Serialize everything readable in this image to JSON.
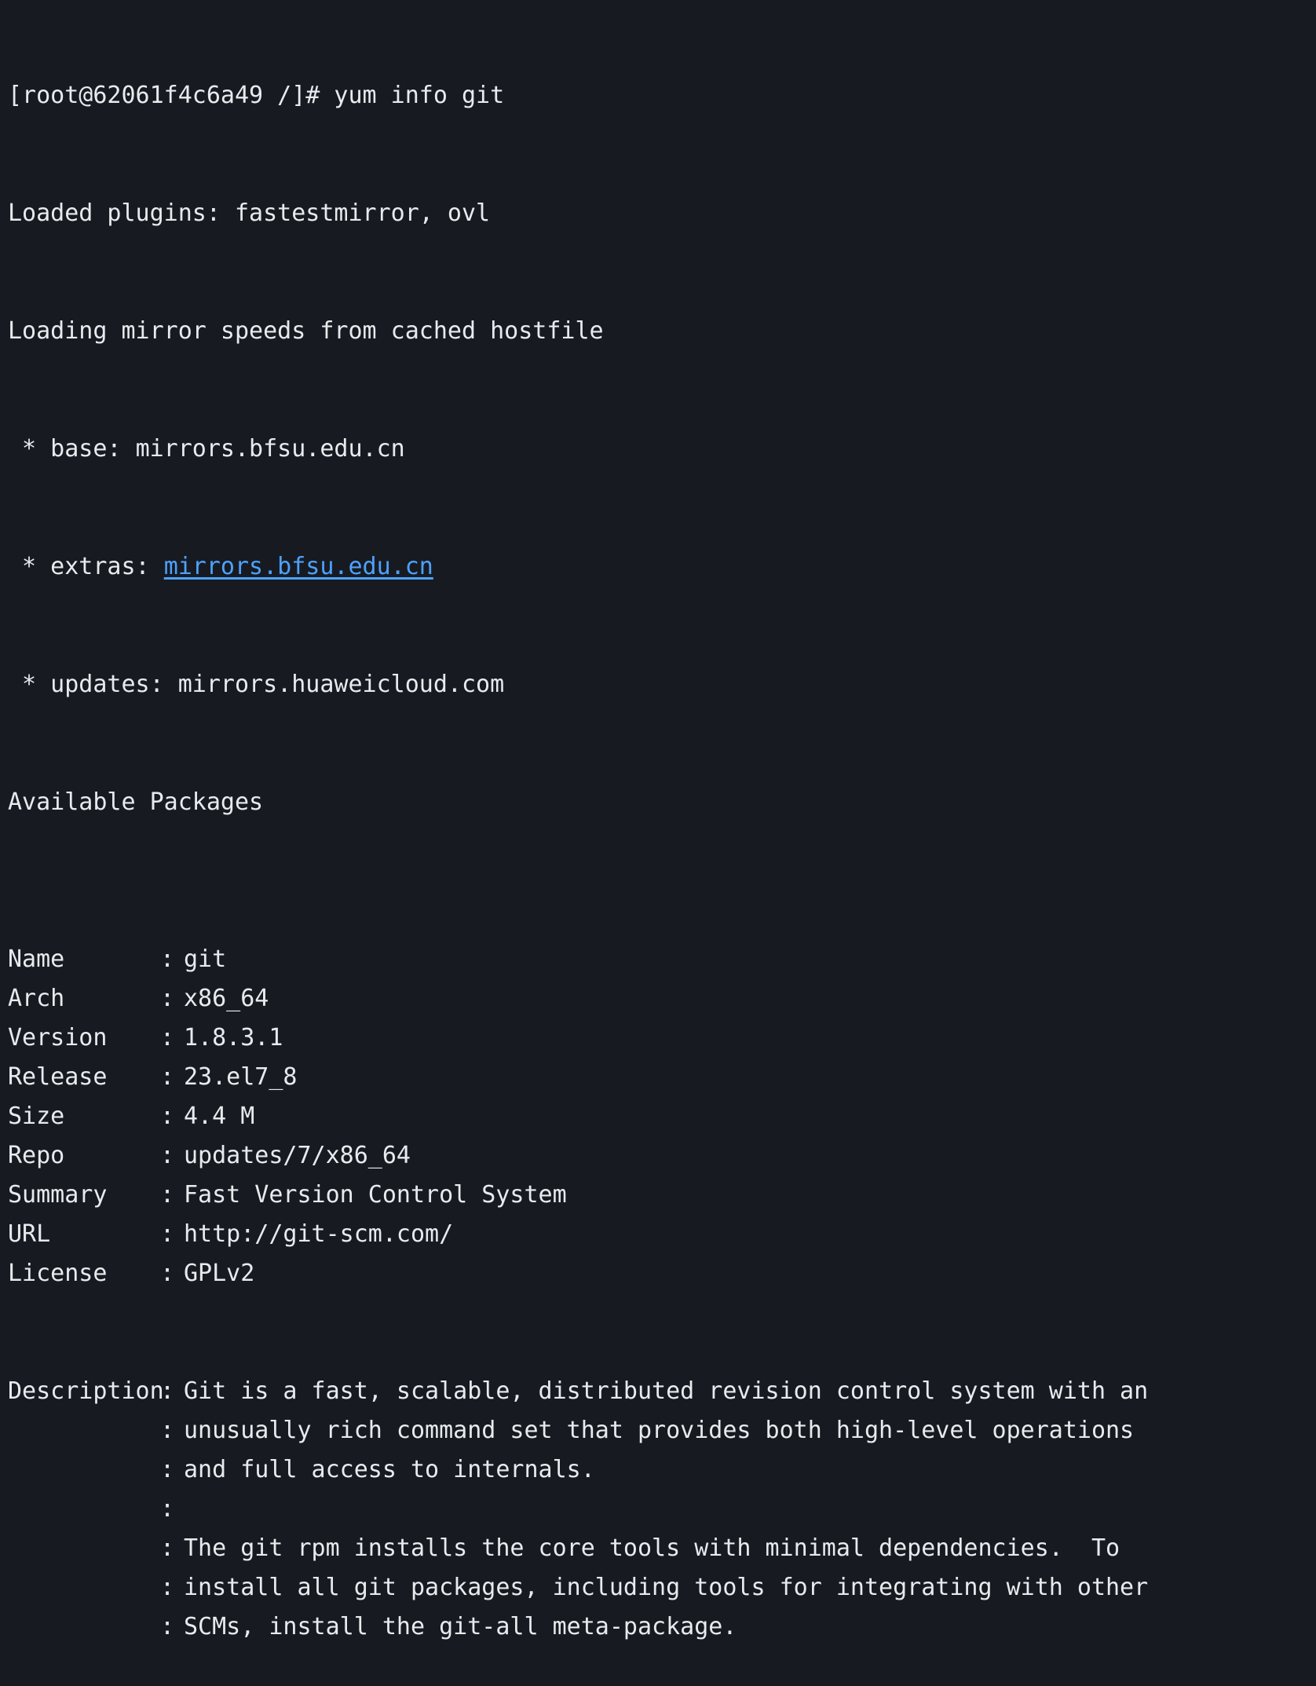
{
  "terminal": {
    "prompt_line": "[root@62061f4c6a49 /]# yum info git",
    "plugins_line": "Loaded plugins: fastestmirror, ovl",
    "mirror_line": "Loading mirror speeds from cached hostfile",
    "base": {
      "prefix": " * base: ",
      "host": "mirrors.bfsu.edu.cn"
    },
    "extras": {
      "prefix": " * extras: ",
      "host": "mirrors.bfsu.edu.cn"
    },
    "updates": {
      "prefix": " * updates: ",
      "host": "mirrors.huaweicloud.com"
    },
    "available_heading": "Available Packages",
    "separator": ": ",
    "fields": [
      {
        "key": "Name",
        "value": "git"
      },
      {
        "key": "Arch",
        "value": "x86_64"
      },
      {
        "key": "Version",
        "value": "1.8.3.1"
      },
      {
        "key": "Release",
        "value": "23.el7_8"
      },
      {
        "key": "Size",
        "value": "4.4 M"
      },
      {
        "key": "Repo",
        "value": "updates/7/x86_64"
      },
      {
        "key": "Summary",
        "value": "Fast Version Control System"
      },
      {
        "key": "URL",
        "value": "http://git-scm.com/"
      },
      {
        "key": "License",
        "value": "GPLv2"
      }
    ],
    "description_key": "Description",
    "description_lines": [
      "Git is a fast, scalable, distributed revision control system with an",
      "unusually rich command set that provides both high-level operations",
      "and full access to internals.",
      "",
      "The git rpm installs the core tools with minimal dependencies.  To",
      "install all git packages, including tools for integrating with other",
      "SCMs, install the git-all meta-package."
    ]
  }
}
